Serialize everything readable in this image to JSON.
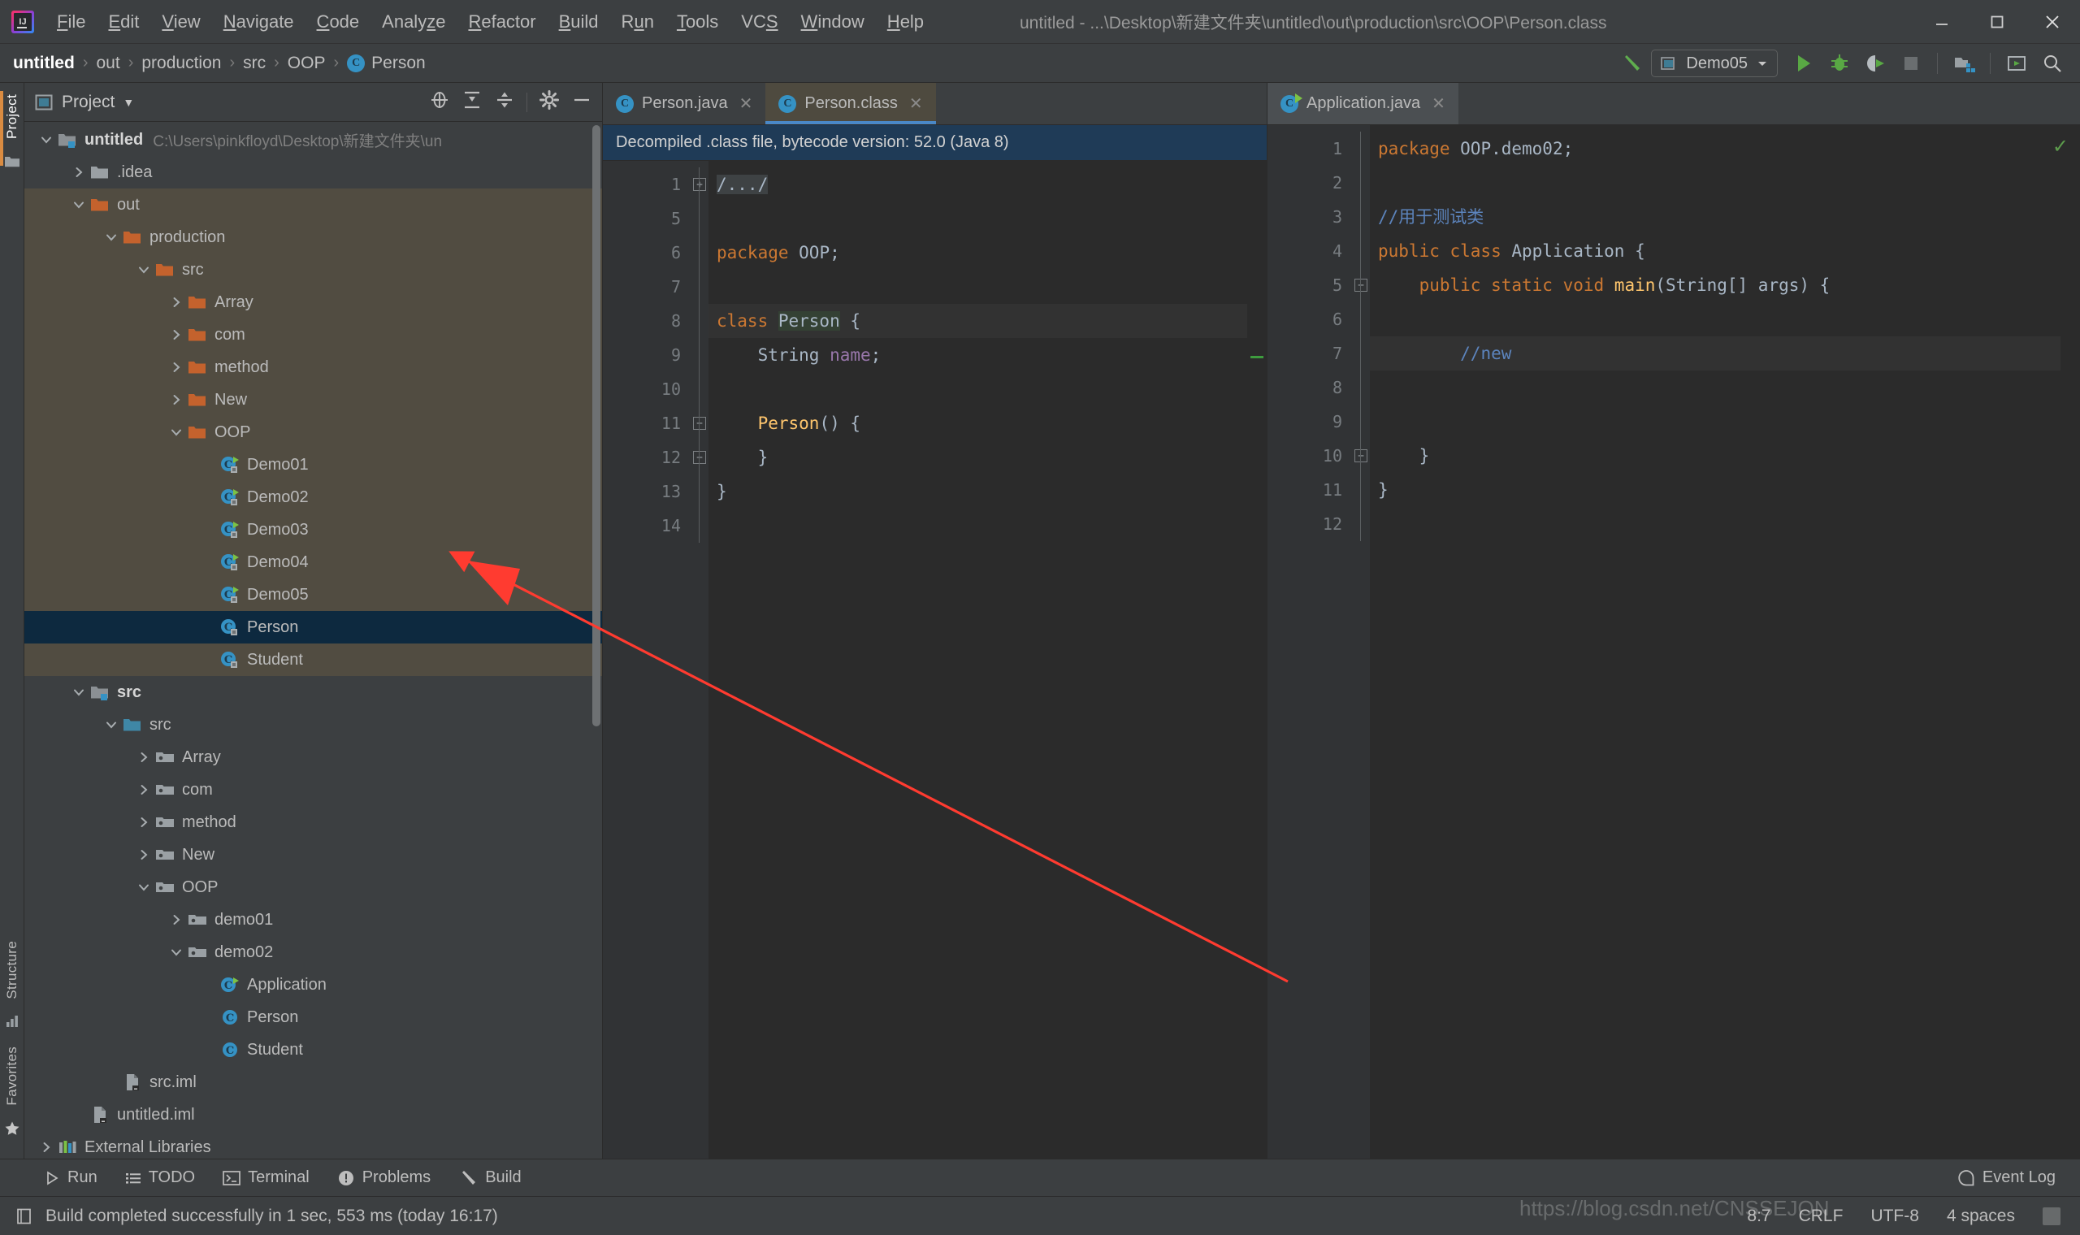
{
  "window": {
    "title": "untitled - ...\\Desktop\\新建文件夹\\untitled\\out\\production\\src\\OOP\\Person.class",
    "minimize_label": "Minimize",
    "maximize_label": "Maximize",
    "close_label": "Close"
  },
  "menubar": {
    "items": [
      {
        "label": "File",
        "mnemonic": "F"
      },
      {
        "label": "Edit",
        "mnemonic": "E"
      },
      {
        "label": "View",
        "mnemonic": "V"
      },
      {
        "label": "Navigate",
        "mnemonic": "N"
      },
      {
        "label": "Code",
        "mnemonic": "C"
      },
      {
        "label": "Analyze",
        "mnemonic": "z"
      },
      {
        "label": "Refactor",
        "mnemonic": "R"
      },
      {
        "label": "Build",
        "mnemonic": "B"
      },
      {
        "label": "Run",
        "mnemonic": "u"
      },
      {
        "label": "Tools",
        "mnemonic": "T"
      },
      {
        "label": "VCS",
        "mnemonic": "S"
      },
      {
        "label": "Window",
        "mnemonic": "W"
      },
      {
        "label": "Help",
        "mnemonic": "H"
      }
    ]
  },
  "navbar": {
    "breadcrumb": [
      "untitled",
      "out",
      "production",
      "src",
      "OOP",
      "Person"
    ],
    "separator": "›",
    "run_config": "Demo05",
    "buttons": {
      "build": "Build",
      "run": "Run",
      "debug": "Debug",
      "run_coverage": "Run with Coverage",
      "stop": "Stop",
      "project_structure": "Project Structure",
      "settings": "Settings",
      "search": "Search Everywhere"
    }
  },
  "left_strip": {
    "project_tab": "Project",
    "structure_tab": "Structure",
    "favorites_tab": "Favorites"
  },
  "project_panel": {
    "title": "Project",
    "actions": {
      "locate": "Select Opened File",
      "expand_all": "Expand All",
      "collapse_all": "Collapse All",
      "settings": "Settings",
      "hide": "Hide"
    },
    "tree": [
      {
        "label": "untitled",
        "path": "C:\\Users\\pinkfloyd\\Desktop\\新建文件夹\\un",
        "indent": 0,
        "arrow": "down",
        "icon": "project-folder",
        "bold": true,
        "state": "normal"
      },
      {
        "label": ".idea",
        "path": "",
        "indent": 1,
        "arrow": "right",
        "icon": "gray-folder",
        "bold": false,
        "state": "normal"
      },
      {
        "label": "out",
        "path": "",
        "indent": 1,
        "arrow": "down",
        "icon": "orange-folder",
        "bold": false,
        "state": "excluded"
      },
      {
        "label": "production",
        "path": "",
        "indent": 2,
        "arrow": "down",
        "icon": "orange-folder",
        "bold": false,
        "state": "excluded"
      },
      {
        "label": "src",
        "path": "",
        "indent": 3,
        "arrow": "down",
        "icon": "orange-folder",
        "bold": false,
        "state": "excluded"
      },
      {
        "label": "Array",
        "path": "",
        "indent": 4,
        "arrow": "right",
        "icon": "orange-folder",
        "bold": false,
        "state": "excluded"
      },
      {
        "label": "com",
        "path": "",
        "indent": 4,
        "arrow": "right",
        "icon": "orange-folder",
        "bold": false,
        "state": "excluded"
      },
      {
        "label": "method",
        "path": "",
        "indent": 4,
        "arrow": "right",
        "icon": "orange-folder",
        "bold": false,
        "state": "excluded"
      },
      {
        "label": "New",
        "path": "",
        "indent": 4,
        "arrow": "right",
        "icon": "orange-folder",
        "bold": false,
        "state": "excluded"
      },
      {
        "label": "OOP",
        "path": "",
        "indent": 4,
        "arrow": "down",
        "icon": "orange-folder",
        "bold": false,
        "state": "excluded"
      },
      {
        "label": "Demo01",
        "path": "",
        "indent": 5,
        "arrow": "none",
        "icon": "class-run-locked",
        "bold": false,
        "state": "excluded"
      },
      {
        "label": "Demo02",
        "path": "",
        "indent": 5,
        "arrow": "none",
        "icon": "class-run-locked",
        "bold": false,
        "state": "excluded"
      },
      {
        "label": "Demo03",
        "path": "",
        "indent": 5,
        "arrow": "none",
        "icon": "class-run-locked",
        "bold": false,
        "state": "excluded"
      },
      {
        "label": "Demo04",
        "path": "",
        "indent": 5,
        "arrow": "none",
        "icon": "class-run-locked",
        "bold": false,
        "state": "excluded"
      },
      {
        "label": "Demo05",
        "path": "",
        "indent": 5,
        "arrow": "none",
        "icon": "class-run-locked",
        "bold": false,
        "state": "excluded"
      },
      {
        "label": "Person",
        "path": "",
        "indent": 5,
        "arrow": "none",
        "icon": "class-locked",
        "bold": false,
        "state": "selected"
      },
      {
        "label": "Student",
        "path": "",
        "indent": 5,
        "arrow": "none",
        "icon": "class-locked",
        "bold": false,
        "state": "excluded"
      },
      {
        "label": "src",
        "path": "",
        "indent": 1,
        "arrow": "down",
        "icon": "module-folder",
        "bold": true,
        "state": "normal"
      },
      {
        "label": "src",
        "path": "",
        "indent": 2,
        "arrow": "down",
        "icon": "source-root",
        "bold": false,
        "state": "normal"
      },
      {
        "label": "Array",
        "path": "",
        "indent": 3,
        "arrow": "right",
        "icon": "package",
        "bold": false,
        "state": "normal"
      },
      {
        "label": "com",
        "path": "",
        "indent": 3,
        "arrow": "right",
        "icon": "package",
        "bold": false,
        "state": "normal"
      },
      {
        "label": "method",
        "path": "",
        "indent": 3,
        "arrow": "right",
        "icon": "package",
        "bold": false,
        "state": "normal"
      },
      {
        "label": "New",
        "path": "",
        "indent": 3,
        "arrow": "right",
        "icon": "package",
        "bold": false,
        "state": "normal"
      },
      {
        "label": "OOP",
        "path": "",
        "indent": 3,
        "arrow": "down",
        "icon": "package",
        "bold": false,
        "state": "normal"
      },
      {
        "label": "demo01",
        "path": "",
        "indent": 4,
        "arrow": "right",
        "icon": "package",
        "bold": false,
        "state": "normal"
      },
      {
        "label": "demo02",
        "path": "",
        "indent": 4,
        "arrow": "down",
        "icon": "package",
        "bold": false,
        "state": "normal"
      },
      {
        "label": "Application",
        "path": "",
        "indent": 5,
        "arrow": "none",
        "icon": "class-run",
        "bold": false,
        "state": "normal"
      },
      {
        "label": "Person",
        "path": "",
        "indent": 5,
        "arrow": "none",
        "icon": "class",
        "bold": false,
        "state": "normal"
      },
      {
        "label": "Student",
        "path": "",
        "indent": 5,
        "arrow": "none",
        "icon": "class",
        "bold": false,
        "state": "normal"
      },
      {
        "label": "src.iml",
        "path": "",
        "indent": 2,
        "arrow": "none",
        "icon": "iml-file",
        "bold": false,
        "state": "normal"
      },
      {
        "label": "untitled.iml",
        "path": "",
        "indent": 1,
        "arrow": "none",
        "icon": "iml-file",
        "bold": false,
        "state": "normal"
      },
      {
        "label": "External Libraries",
        "path": "",
        "indent": 0,
        "arrow": "right",
        "icon": "libraries",
        "bold": false,
        "state": "normal"
      }
    ]
  },
  "left_editor": {
    "tabs": [
      {
        "label": "Person.java",
        "icon": "class-icon",
        "active": false
      },
      {
        "label": "Person.class",
        "icon": "class-icon",
        "active": true
      }
    ],
    "close_glyph": "✕",
    "notice": "Decompiled .class file, bytecode version: 52.0 (Java 8)",
    "lines": [
      {
        "no": "1",
        "fold": "plus",
        "tokens": [
          {
            "t": "/.../",
            "c": "fold-text"
          }
        ],
        "caret": false
      },
      {
        "no": "5",
        "fold": "",
        "tokens": [],
        "caret": false
      },
      {
        "no": "6",
        "fold": "",
        "tokens": [
          {
            "t": "package ",
            "c": "kw"
          },
          {
            "t": "OOP",
            "c": "plain"
          },
          {
            "t": ";",
            "c": "plain"
          }
        ],
        "caret": false
      },
      {
        "no": "7",
        "fold": "",
        "tokens": [],
        "caret": false
      },
      {
        "no": "8",
        "fold": "",
        "tokens": [
          {
            "t": "class ",
            "c": "kw"
          },
          {
            "t": "Person",
            "c": "plain ident-hl"
          },
          {
            "t": " {",
            "c": "plain"
          }
        ],
        "caret": true
      },
      {
        "no": "9",
        "fold": "",
        "tokens": [
          {
            "t": "    String ",
            "c": "plain"
          },
          {
            "t": "name",
            "c": "field"
          },
          {
            "t": ";",
            "c": "plain"
          }
        ],
        "caret": false
      },
      {
        "no": "10",
        "fold": "",
        "tokens": [],
        "caret": false
      },
      {
        "no": "11",
        "fold": "minus-top",
        "tokens": [
          {
            "t": "    ",
            "c": "plain"
          },
          {
            "t": "Person",
            "c": "fn"
          },
          {
            "t": "() {",
            "c": "plain"
          }
        ],
        "caret": false
      },
      {
        "no": "12",
        "fold": "minus-bot",
        "tokens": [
          {
            "t": "    }",
            "c": "plain"
          }
        ],
        "caret": false
      },
      {
        "no": "13",
        "fold": "",
        "tokens": [
          {
            "t": "}",
            "c": "plain"
          }
        ],
        "caret": false
      },
      {
        "no": "14",
        "fold": "",
        "tokens": [],
        "caret": false
      }
    ]
  },
  "right_editor": {
    "tabs": [
      {
        "label": "Application.java",
        "icon": "class-run-icon",
        "active": true
      }
    ],
    "close_glyph": "✕",
    "lines": [
      {
        "no": "1",
        "run": false,
        "fold": "",
        "tokens": [
          {
            "t": "package ",
            "c": "kw"
          },
          {
            "t": "OOP.demo02",
            "c": "plain"
          },
          {
            "t": ";",
            "c": "plain"
          }
        ],
        "caret": false
      },
      {
        "no": "2",
        "run": false,
        "fold": "",
        "tokens": [],
        "caret": false
      },
      {
        "no": "3",
        "run": false,
        "fold": "",
        "tokens": [
          {
            "t": "//用于测试类",
            "c": "cmt-blue"
          }
        ],
        "caret": false
      },
      {
        "no": "4",
        "run": true,
        "fold": "",
        "tokens": [
          {
            "t": "public class ",
            "c": "kw"
          },
          {
            "t": "Application",
            "c": "plain"
          },
          {
            "t": " {",
            "c": "plain"
          }
        ],
        "caret": false
      },
      {
        "no": "5",
        "run": true,
        "fold": "minus-top",
        "tokens": [
          {
            "t": "    public static void ",
            "c": "kw"
          },
          {
            "t": "main",
            "c": "fn"
          },
          {
            "t": "(String[] args) {",
            "c": "plain"
          }
        ],
        "caret": false
      },
      {
        "no": "6",
        "run": false,
        "fold": "",
        "tokens": [],
        "caret": false
      },
      {
        "no": "7",
        "run": false,
        "fold": "",
        "tokens": [
          {
            "t": "        ",
            "c": "plain"
          },
          {
            "t": "//new",
            "c": "cmt-blue"
          }
        ],
        "caret": true
      },
      {
        "no": "8",
        "run": false,
        "fold": "",
        "tokens": [],
        "caret": false
      },
      {
        "no": "9",
        "run": false,
        "fold": "",
        "tokens": [],
        "caret": false
      },
      {
        "no": "10",
        "run": false,
        "fold": "minus-bot",
        "tokens": [
          {
            "t": "    }",
            "c": "plain"
          }
        ],
        "caret": false
      },
      {
        "no": "11",
        "run": false,
        "fold": "",
        "tokens": [
          {
            "t": "}",
            "c": "plain"
          }
        ],
        "caret": false
      },
      {
        "no": "12",
        "run": false,
        "fold": "",
        "tokens": [],
        "caret": false
      }
    ]
  },
  "toolwindow_bar": {
    "items": [
      {
        "label": "Run",
        "icon": "play-icon"
      },
      {
        "label": "TODO",
        "icon": "list-icon"
      },
      {
        "label": "Terminal",
        "icon": "terminal-icon"
      },
      {
        "label": "Problems",
        "icon": "problems-icon"
      },
      {
        "label": "Build",
        "icon": "hammer-icon"
      }
    ],
    "event_log": "Event Log"
  },
  "statusbar": {
    "message": "Build completed successfully in 1 sec, 553 ms (today 16:17)",
    "caret_position": "8:7",
    "line_separator": "CRLF",
    "encoding": "UTF-8",
    "indent": "4 spaces",
    "watermark": "https://blog.csdn.net/CNSSEJON"
  },
  "colors": {
    "accent_blue": "#4a88c7",
    "selection_navy": "#0d293f",
    "excluded_olive": "#514c41",
    "keyword_orange": "#cc7832",
    "comment_blue": "#5c84bd",
    "class_icon_teal": "#3592c4",
    "run_green": "#4f9c3f",
    "annotation_red": "#ff3b30"
  }
}
